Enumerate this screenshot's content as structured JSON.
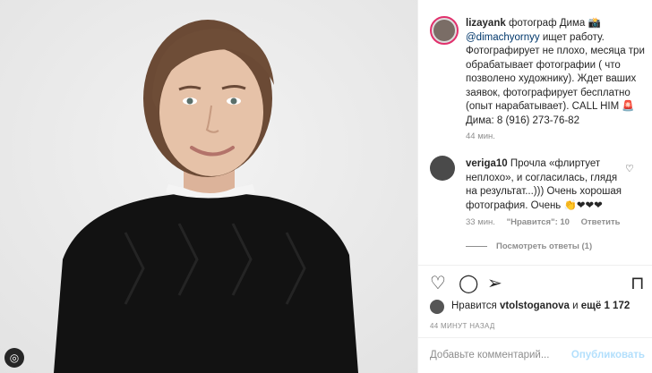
{
  "post": {
    "username": "lizayank",
    "caption_a": "фотограф Дима",
    "camera_emoji": "📸",
    "mention": "@dimachyornyy",
    "caption_b": "ищет работу. Фотографирует не плохо, месяца три обрабатывает фотографии ( что позволено художнику). Ждет ваших заявок, фотографирует бесплатно (опыт нарабатывает). CALL HIM",
    "siren_emoji": "🚨",
    "caption_c": "Дима: 8 (916) 273-76-82",
    "time": "44 мин."
  },
  "comment": {
    "username": "veriga10",
    "text": "Прочла «флиртует неплохо», и согласилась, глядя на результат...))) Очень хорошая фотография. Очень",
    "emojis": "👏❤❤❤",
    "time": "33 мин.",
    "likes": "\"Нравится\": 10",
    "reply": "Ответить",
    "view_replies": "Посмотреть ответы (1)"
  },
  "likes": {
    "text_a": "Нравится",
    "user": "vtolstoganova",
    "text_b": "и",
    "more": "ещё 1 172"
  },
  "date": "44 МИНУТ НАЗАД",
  "add_comment": {
    "placeholder": "Добавьте комментарий...",
    "publish": "Опубликовать"
  },
  "colors": {
    "link": "#00376b",
    "muted": "#8e8e8e",
    "publish_disabled": "#b2dffc",
    "heart": "#ed4956"
  },
  "icons": [
    "heart-icon",
    "comment-icon",
    "share-icon",
    "bookmark-icon",
    "instagram-icon"
  ]
}
